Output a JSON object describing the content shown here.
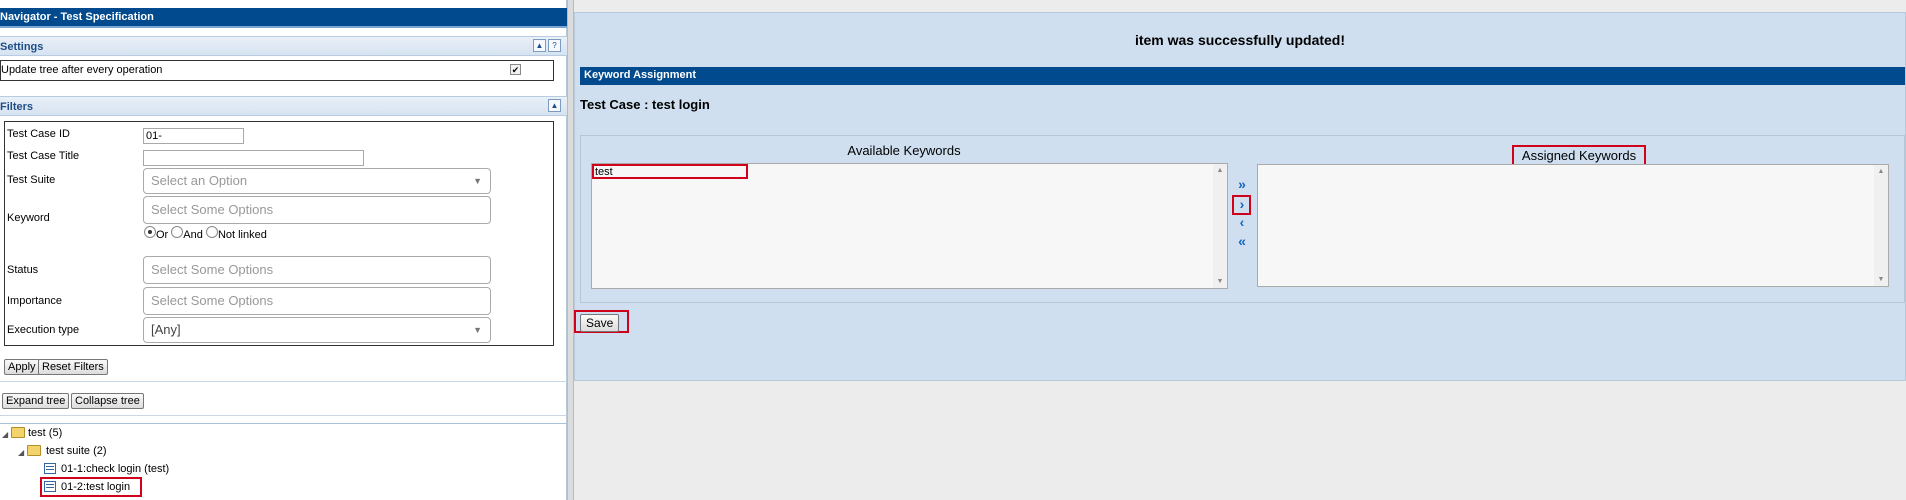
{
  "navigator": {
    "title": "Navigator - Test Specification",
    "settings": {
      "header": "Settings",
      "collapse_glyph": "▲",
      "help_glyph": "?",
      "update_tree_label": "Update tree after every operation",
      "update_tree_checked": true,
      "check_glyph": "✔"
    },
    "filters": {
      "header": "Filters",
      "collapse_glyph": "▲",
      "test_case_id_label": "Test Case ID",
      "test_case_id_value": "01-",
      "test_case_title_label": "Test Case Title",
      "test_case_title_value": "",
      "test_suite_label": "Test Suite",
      "test_suite_placeholder": "Select an Option",
      "keyword_label": "Keyword",
      "keyword_placeholder": "Select Some Options",
      "keyword_logic": {
        "or": "Or",
        "and": "And",
        "not_linked": "Not linked",
        "selected": "Or"
      },
      "status_label": "Status",
      "status_placeholder": "Select Some Options",
      "importance_label": "Importance",
      "importance_placeholder": "Select Some Options",
      "execution_type_label": "Execution type",
      "execution_type_value": "[Any]",
      "apply_label": "Apply",
      "reset_label": "Reset Filters"
    },
    "tree_buttons": {
      "expand": "Expand tree",
      "collapse": "Collapse tree"
    },
    "tree": {
      "root": "test (5)",
      "suite": "test suite (2)",
      "cases": [
        "01-1:check login (test)",
        "01-2:test login"
      ]
    }
  },
  "main": {
    "message": "item was successfully updated!",
    "panel_title": "Keyword Assignment",
    "test_case_heading": "Test Case : test login",
    "available_header": "Available Keywords",
    "assigned_header": "Assigned Keywords",
    "available_keywords": [
      "test"
    ],
    "assigned_keywords": [],
    "transfer_glyphs": {
      "add_all": "»",
      "add": "›",
      "remove": "‹",
      "remove_all": "«"
    },
    "save_label": "Save"
  },
  "colors": {
    "title_bar": "#004a8d",
    "panel_background": "#cfdff0",
    "highlight": "#d0021b",
    "arrow": "#1565c0"
  }
}
